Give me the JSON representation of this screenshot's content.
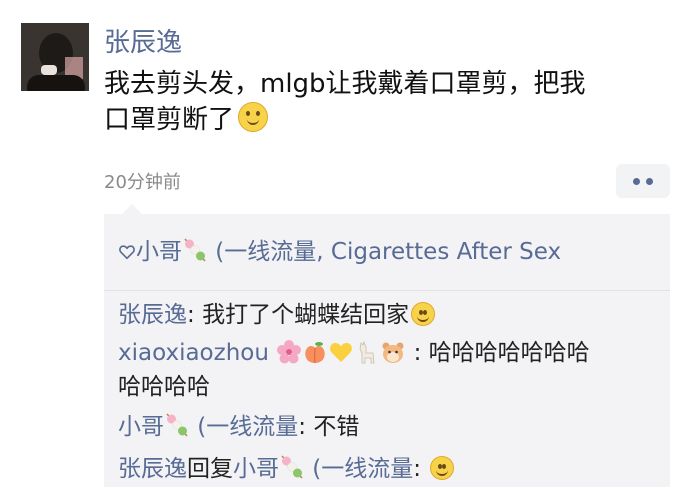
{
  "post": {
    "author": "张辰逸",
    "text_line1": "我去剪头发，mlgb让我戴着口罩剪，把我",
    "text_line2": "口罩剪断了",
    "time": "20分钟前"
  },
  "likes": {
    "users": "小哥",
    "users_rest": " (一线流量, Cigarettes After Sex"
  },
  "comments": [
    {
      "name": "张辰逸",
      "sep": ": ",
      "text": "我打了个蝴蝶结回家"
    },
    {
      "name": "xiaoxiaozhou",
      "sep": ": ",
      "text": "哈哈哈哈哈哈哈",
      "text2": "哈哈哈哈"
    },
    {
      "name": "小哥",
      "name_rest": " (一线流量",
      "sep": ": ",
      "text": "不错"
    },
    {
      "name": "张辰逸",
      "reply_word": "回复",
      "reply_to": "小哥",
      "reply_rest": " (一线流量",
      "sep": ": "
    }
  ],
  "icons": {
    "heart": "heart-outline-icon",
    "dango": "dango-icon",
    "smile": "smile-emoji-icon",
    "more": "more-dots-icon"
  },
  "colors": {
    "link": "#576b95",
    "comment_bg": "#f3f3f5",
    "time": "#8a8a8a"
  }
}
